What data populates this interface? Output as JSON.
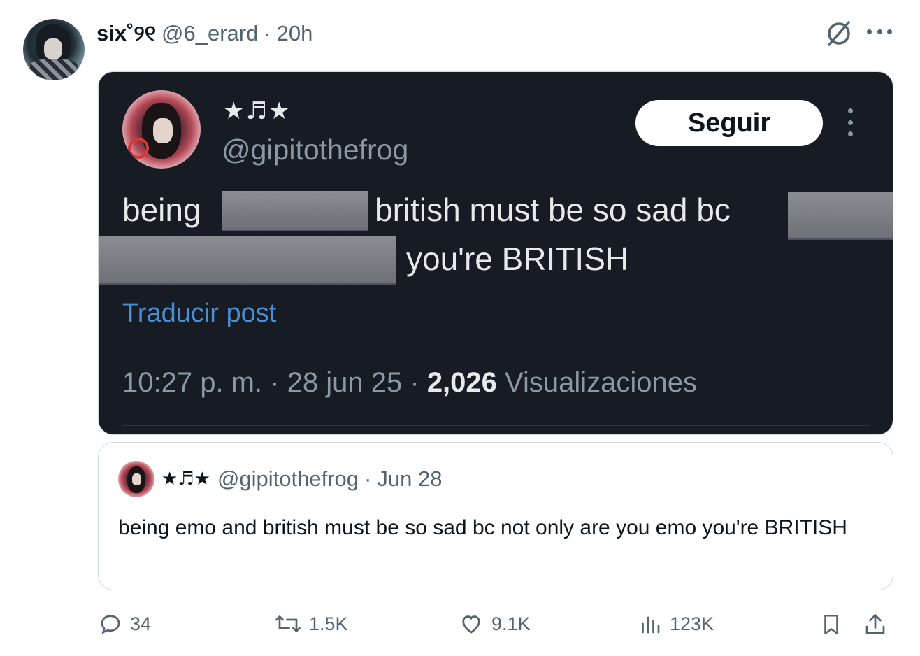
{
  "post": {
    "author_name": "six˚୨୧",
    "handle": "@6_erard",
    "separator": "·",
    "time": "20h"
  },
  "embedded_screenshot": {
    "display_name": "★♬★",
    "handle": "@gipitothefrog",
    "follow_label": "Seguir",
    "line1_a": "being",
    "line1_b": "british must be so sad bc",
    "line2": "you're BRITISH",
    "translate_label": "Traducir post",
    "meta_time": "10:27 p. m. · 28 jun 25 · ",
    "meta_views_count": "2,026",
    "meta_views_label": " Visualizaciones"
  },
  "quoted_post": {
    "display_name": "★♬★",
    "handle": "@gipitothefrog",
    "separator": "·",
    "date": "Jun 28",
    "text": "being emo and british must be so sad bc not only are you emo you're BRITISH"
  },
  "actions": {
    "replies": "34",
    "reposts": "1.5K",
    "likes": "9.1K",
    "views": "123K"
  },
  "icons": {
    "grok": "grok-icon",
    "more": "more-icon",
    "reply": "reply-icon",
    "repost": "repost-icon",
    "like": "heart-icon",
    "views": "bar-chart-icon",
    "bookmark": "bookmark-icon",
    "share": "share-icon"
  },
  "colors": {
    "text_primary": "#0f1419",
    "text_secondary": "#536471",
    "dark_bg": "#161b24",
    "link_blue": "#4a8fd4"
  }
}
